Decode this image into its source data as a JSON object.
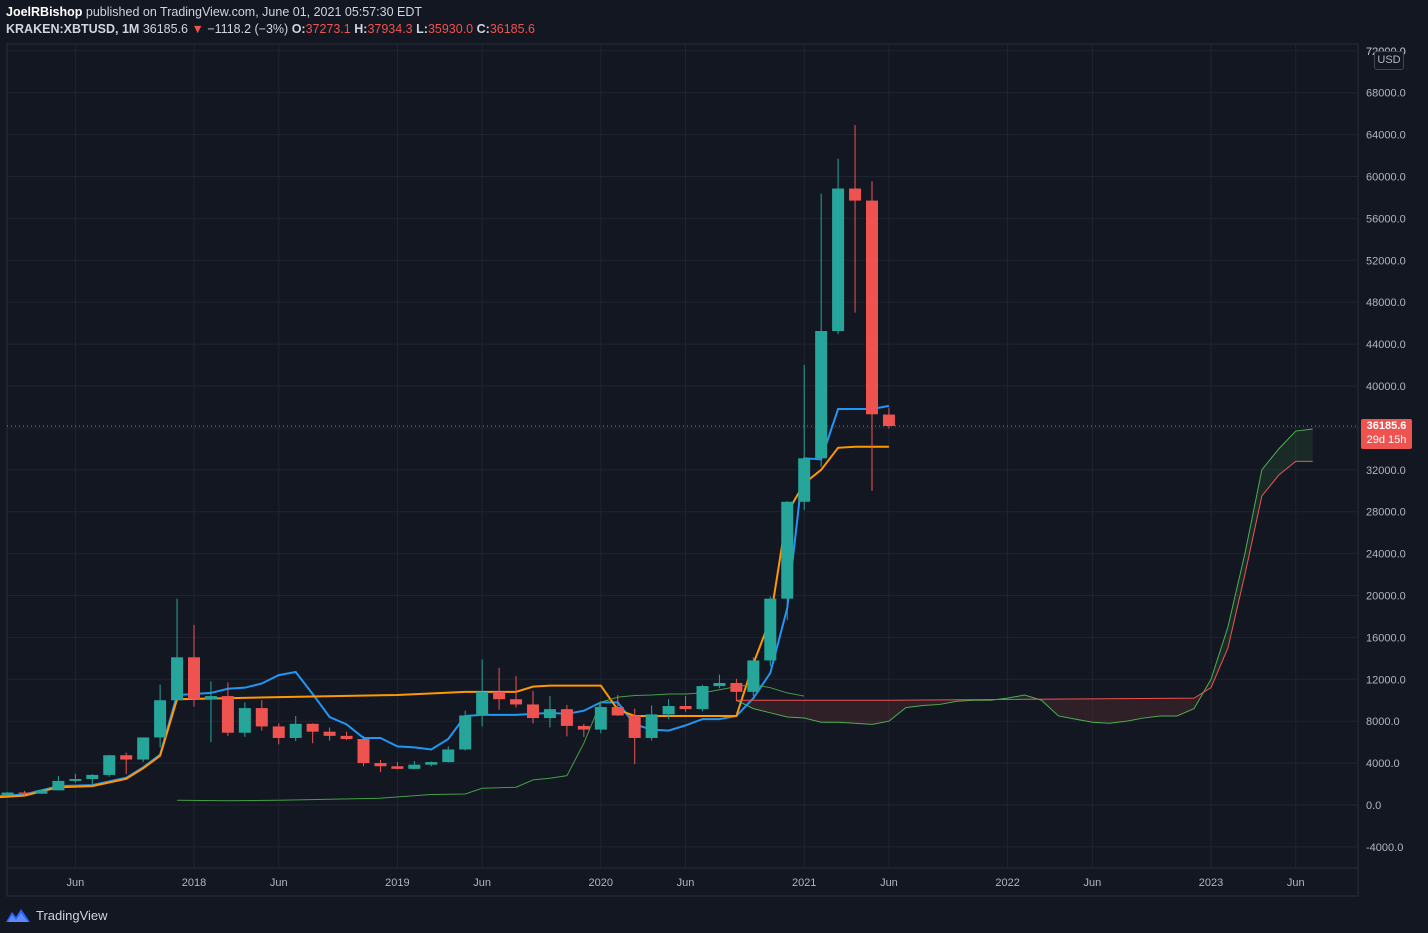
{
  "header": {
    "publisher": "JoelRBishop",
    "published_text": "published on TradingView.com, June 01, 2021 05:57:30 EDT",
    "symbol": "KRAKEN:XBTUSD, 1M",
    "last": "36185.6",
    "change_arrow": "▼",
    "change": "−1118.2 (−3%)",
    "o_label": "O:",
    "o_value": "37273.1",
    "h_label": "H:",
    "h_value": "37934.3",
    "l_label": "L:",
    "l_value": "35930.0",
    "c_label": "C:",
    "c_value": "36185.6"
  },
  "currency_label": "USD",
  "price_badge": {
    "price": "36185.6",
    "countdown": "29d 15h"
  },
  "footer": {
    "brand": "TradingView",
    "icon": "tradingview-logo-icon"
  },
  "colors": {
    "background": "#131722",
    "grid": "#1f2430",
    "up": "#26a69a",
    "down": "#ef5350",
    "tenkan": "#2196f3",
    "kijun": "#ff9800",
    "span_a": "#4caf50",
    "span_b": "#ef5350",
    "lagging": "#43a047"
  },
  "chart_data": {
    "type": "candlestick",
    "title": "KRAKEN:XBTUSD, 1M",
    "ylim": [
      -6000,
      72000
    ],
    "y_ticks": [
      "-4000.0",
      "0.0",
      "4000.0",
      "8000.0",
      "12000.0",
      "16000.0",
      "20000.0",
      "24000.0",
      "28000.0",
      "32000.0",
      "36000.0",
      "40000.0",
      "44000.0",
      "48000.0",
      "52000.0",
      "56000.0",
      "60000.0",
      "64000.0",
      "68000.0",
      "72000.0"
    ],
    "x_ticks": [
      "Jun",
      "2018",
      "Jun",
      "2019",
      "Jun",
      "2020",
      "Jun",
      "2021",
      "Jun",
      "2022",
      "Jun",
      "2023",
      "Jun"
    ],
    "candles": [
      {
        "date": "2017-01",
        "o": 960,
        "h": 1150,
        "l": 780,
        "c": 965
      },
      {
        "date": "2017-02",
        "o": 965,
        "h": 1220,
        "l": 930,
        "c": 1190
      },
      {
        "date": "2017-03",
        "o": 1190,
        "h": 1350,
        "l": 890,
        "c": 1080
      },
      {
        "date": "2017-04",
        "o": 1080,
        "h": 1430,
        "l": 1060,
        "c": 1400
      },
      {
        "date": "2017-05",
        "o": 1400,
        "h": 2760,
        "l": 1400,
        "c": 2300
      },
      {
        "date": "2017-06",
        "o": 2300,
        "h": 2990,
        "l": 2100,
        "c": 2480
      },
      {
        "date": "2017-07",
        "o": 2480,
        "h": 2950,
        "l": 1830,
        "c": 2870
      },
      {
        "date": "2017-08",
        "o": 2870,
        "h": 4780,
        "l": 2700,
        "c": 4750
      },
      {
        "date": "2017-09",
        "o": 4750,
        "h": 5000,
        "l": 2950,
        "c": 4340
      },
      {
        "date": "2017-10",
        "o": 4340,
        "h": 6450,
        "l": 4100,
        "c": 6450
      },
      {
        "date": "2017-11",
        "o": 6450,
        "h": 11500,
        "l": 5500,
        "c": 10000
      },
      {
        "date": "2017-12",
        "o": 10000,
        "h": 19700,
        "l": 10000,
        "c": 14100
      },
      {
        "date": "2018-01",
        "o": 14100,
        "h": 17200,
        "l": 9400,
        "c": 10100
      },
      {
        "date": "2018-02",
        "o": 10100,
        "h": 11800,
        "l": 6000,
        "c": 10400
      },
      {
        "date": "2018-03",
        "o": 10400,
        "h": 11700,
        "l": 6600,
        "c": 6900
      },
      {
        "date": "2018-04",
        "o": 6900,
        "h": 9800,
        "l": 6500,
        "c": 9250
      },
      {
        "date": "2018-05",
        "o": 9250,
        "h": 10000,
        "l": 7100,
        "c": 7500
      },
      {
        "date": "2018-06",
        "o": 7500,
        "h": 7800,
        "l": 5800,
        "c": 6400
      },
      {
        "date": "2018-07",
        "o": 6400,
        "h": 8500,
        "l": 6100,
        "c": 7750
      },
      {
        "date": "2018-08",
        "o": 7750,
        "h": 7800,
        "l": 5900,
        "c": 7000
      },
      {
        "date": "2018-09",
        "o": 7000,
        "h": 7400,
        "l": 6150,
        "c": 6600
      },
      {
        "date": "2018-10",
        "o": 6600,
        "h": 7000,
        "l": 6200,
        "c": 6300
      },
      {
        "date": "2018-11",
        "o": 6300,
        "h": 6600,
        "l": 3700,
        "c": 4000
      },
      {
        "date": "2018-12",
        "o": 4000,
        "h": 4300,
        "l": 3150,
        "c": 3700
      },
      {
        "date": "2019-01",
        "o": 3700,
        "h": 4100,
        "l": 3400,
        "c": 3450
      },
      {
        "date": "2019-02",
        "o": 3450,
        "h": 4200,
        "l": 3400,
        "c": 3850
      },
      {
        "date": "2019-03",
        "o": 3850,
        "h": 4150,
        "l": 3700,
        "c": 4100
      },
      {
        "date": "2019-04",
        "o": 4100,
        "h": 5600,
        "l": 4050,
        "c": 5300
      },
      {
        "date": "2019-05",
        "o": 5300,
        "h": 9000,
        "l": 5200,
        "c": 8550
      },
      {
        "date": "2019-06",
        "o": 8550,
        "h": 13900,
        "l": 7500,
        "c": 10800
      },
      {
        "date": "2019-07",
        "o": 10800,
        "h": 13100,
        "l": 9100,
        "c": 10100
      },
      {
        "date": "2019-08",
        "o": 10100,
        "h": 12300,
        "l": 9300,
        "c": 9600
      },
      {
        "date": "2019-09",
        "o": 9600,
        "h": 10900,
        "l": 7800,
        "c": 8300
      },
      {
        "date": "2019-10",
        "o": 8300,
        "h": 10400,
        "l": 7400,
        "c": 9150
      },
      {
        "date": "2019-11",
        "o": 9150,
        "h": 9550,
        "l": 6550,
        "c": 7550
      },
      {
        "date": "2019-12",
        "o": 7550,
        "h": 7750,
        "l": 6500,
        "c": 7200
      },
      {
        "date": "2020-01",
        "o": 7200,
        "h": 9600,
        "l": 6850,
        "c": 9350
      },
      {
        "date": "2020-02",
        "o": 9350,
        "h": 10500,
        "l": 8500,
        "c": 8550
      },
      {
        "date": "2020-03",
        "o": 8550,
        "h": 9200,
        "l": 3900,
        "c": 6400
      },
      {
        "date": "2020-04",
        "o": 6400,
        "h": 9500,
        "l": 6150,
        "c": 8650
      },
      {
        "date": "2020-05",
        "o": 8650,
        "h": 10100,
        "l": 8200,
        "c": 9450
      },
      {
        "date": "2020-06",
        "o": 9450,
        "h": 10400,
        "l": 8900,
        "c": 9150
      },
      {
        "date": "2020-07",
        "o": 9150,
        "h": 11450,
        "l": 8950,
        "c": 11350
      },
      {
        "date": "2020-08",
        "o": 11350,
        "h": 12450,
        "l": 11150,
        "c": 11650
      },
      {
        "date": "2020-09",
        "o": 11650,
        "h": 12050,
        "l": 9900,
        "c": 10800
      },
      {
        "date": "2020-10",
        "o": 10800,
        "h": 14100,
        "l": 10400,
        "c": 13800
      },
      {
        "date": "2020-11",
        "o": 13800,
        "h": 19900,
        "l": 13250,
        "c": 19700
      },
      {
        "date": "2020-12",
        "o": 19700,
        "h": 29000,
        "l": 17650,
        "c": 28950
      },
      {
        "date": "2021-01",
        "o": 28950,
        "h": 42000,
        "l": 28150,
        "c": 33100
      },
      {
        "date": "2021-02",
        "o": 33100,
        "h": 58350,
        "l": 32300,
        "c": 45250
      },
      {
        "date": "2021-03",
        "o": 45250,
        "h": 61700,
        "l": 44950,
        "c": 58850
      },
      {
        "date": "2021-04",
        "o": 58850,
        "h": 64900,
        "l": 47000,
        "c": 57700
      },
      {
        "date": "2021-05",
        "o": 57700,
        "h": 59550,
        "l": 30000,
        "c": 37300
      },
      {
        "date": "2021-06",
        "o": 37273.1,
        "h": 37934.3,
        "l": 35930.0,
        "c": 36185.6
      }
    ],
    "series": [
      {
        "name": "tenkan",
        "color": "#2196f3",
        "x": [
          "2017-01",
          "2017-03",
          "2017-05",
          "2017-07",
          "2017-09",
          "2017-10",
          "2017-11",
          "2017-12",
          "2018-01",
          "2018-02",
          "2018-03",
          "2018-04",
          "2018-05",
          "2018-06",
          "2018-07",
          "2018-08",
          "2018-09",
          "2018-10",
          "2018-11",
          "2018-12",
          "2019-01",
          "2019-02",
          "2019-03",
          "2019-04",
          "2019-05",
          "2019-06",
          "2019-07",
          "2019-08",
          "2019-09",
          "2019-10",
          "2019-11",
          "2019-12",
          "2020-01",
          "2020-02",
          "2020-03",
          "2020-04",
          "2020-05",
          "2020-06",
          "2020-07",
          "2020-08",
          "2020-09",
          "2020-10",
          "2020-11",
          "2020-12",
          "2021-01",
          "2021-02",
          "2021-03",
          "2021-04",
          "2021-05",
          "2021-06"
        ],
        "y": [
          800,
          1000,
          1800,
          1900,
          2600,
          3600,
          4800,
          10500,
          10600,
          10700,
          11100,
          11200,
          11600,
          12400,
          12700,
          10600,
          8400,
          7700,
          6400,
          6400,
          5600,
          5500,
          5300,
          6300,
          8500,
          8600,
          8600,
          8600,
          8700,
          8800,
          8700,
          9000,
          9800,
          9800,
          7700,
          7200,
          7100,
          7600,
          8200,
          8200,
          8500,
          10200,
          12600,
          18800,
          33100,
          33000,
          37800,
          37800,
          37800,
          38100
        ]
      },
      {
        "name": "kijun",
        "color": "#ff9800",
        "x": [
          "2017-01",
          "2017-03",
          "2017-05",
          "2017-07",
          "2017-09",
          "2017-10",
          "2017-11",
          "2017-12",
          "2018-06",
          "2019-01",
          "2019-05",
          "2019-08",
          "2019-09",
          "2019-10",
          "2019-11",
          "2019-12",
          "2020-01",
          "2020-02",
          "2020-03",
          "2020-04",
          "2020-05",
          "2020-06",
          "2020-09",
          "2020-10",
          "2020-11",
          "2020-12",
          "2021-01",
          "2021-02",
          "2021-03",
          "2021-04",
          "2021-05",
          "2021-06"
        ],
        "y": [
          700,
          900,
          1700,
          1800,
          2500,
          3500,
          4700,
          10100,
          10300,
          10500,
          10800,
          10800,
          11300,
          11400,
          11400,
          11400,
          11400,
          9100,
          8500,
          8500,
          8500,
          8500,
          8500,
          13500,
          17700,
          27900,
          30700,
          32000,
          34100,
          34200,
          34200,
          34200
        ]
      },
      {
        "name": "span_a",
        "color": "#4caf50",
        "x": [
          "2020-09",
          "2020-10",
          "2020-11",
          "2020-12",
          "2021-01",
          "2021-02",
          "2021-03",
          "2021-04",
          "2021-05",
          "2021-06",
          "2021-07",
          "2021-08",
          "2021-09",
          "2021-10",
          "2021-11",
          "2021-12",
          "2022-01",
          "2022-02",
          "2022-03",
          "2022-04",
          "2022-05",
          "2022-06",
          "2022-07",
          "2022-08",
          "2022-09",
          "2022-10",
          "2022-11",
          "2022-12",
          "2023-01",
          "2023-02",
          "2023-03",
          "2023-04",
          "2023-05",
          "2023-06",
          "2023-07"
        ],
        "y": [
          10000,
          9200,
          8800,
          8400,
          8300,
          7900,
          7900,
          7800,
          7700,
          8000,
          9300,
          9500,
          9600,
          9900,
          10000,
          10000,
          10200,
          10500,
          10000,
          8500,
          8200,
          7900,
          7800,
          8000,
          8300,
          8500,
          8500,
          9200,
          12000,
          17000,
          24000,
          32000,
          34000,
          35700,
          35900
        ]
      },
      {
        "name": "span_b",
        "color": "#ef5350",
        "x": [
          "2020-09",
          "2021-06",
          "2022-12",
          "2023-01",
          "2023-02",
          "2023-03",
          "2023-04",
          "2023-05",
          "2023-06",
          "2023-07"
        ],
        "y": [
          10000,
          10000,
          10200,
          11200,
          15000,
          22000,
          29500,
          31500,
          32800,
          32800
        ]
      },
      {
        "name": "lagging",
        "color": "#43a047",
        "x": [
          "2017-12",
          "2018-03",
          "2018-06",
          "2018-09",
          "2018-12",
          "2019-03",
          "2019-05",
          "2019-06",
          "2019-07",
          "2019-08",
          "2019-09",
          "2019-10",
          "2019-11",
          "2019-12",
          "2020-01",
          "2020-02",
          "2020-03",
          "2020-04",
          "2020-05",
          "2020-06",
          "2020-07",
          "2020-08",
          "2020-09",
          "2020-10",
          "2020-11",
          "2020-12",
          "2021-01"
        ],
        "y": [
          450,
          400,
          450,
          550,
          650,
          1000,
          1050,
          1600,
          1650,
          1700,
          2400,
          2550,
          2800,
          5900,
          9800,
          10300,
          10450,
          10500,
          10600,
          10600,
          10700,
          11000,
          11300,
          11500,
          11200,
          10700,
          10400
        ]
      }
    ],
    "last_price": 36185.6
  }
}
